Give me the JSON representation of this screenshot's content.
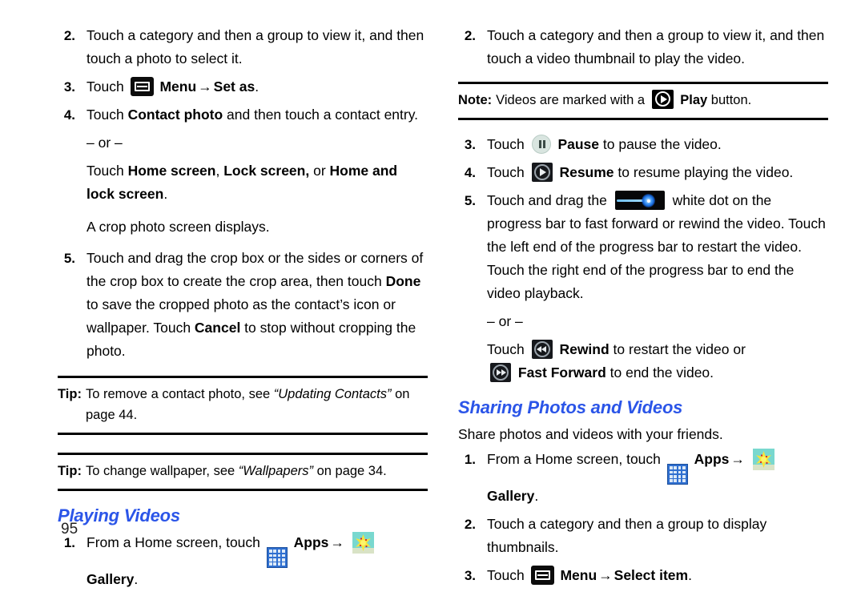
{
  "page_number": "95",
  "left_column": {
    "step2": {
      "num": "2.",
      "text_a": "Touch a category and then a group to view it, and then touch a photo to select it."
    },
    "step3": {
      "num": "3.",
      "lead": "Touch",
      "menu_label": "Menu",
      "arrow": "→",
      "target_label": "Set as",
      "period": "."
    },
    "step4": {
      "num": "4.",
      "lead": "Touch",
      "bold_a": "Contact photo",
      "tail": " and then touch a contact entry.",
      "or": "– or –",
      "alt_lead": "Touch ",
      "alt_b1": "Home screen",
      "alt_sep1": ", ",
      "alt_b2": "Lock screen,",
      "alt_sep2": " or ",
      "alt_b3": "Home and lock screen",
      "alt_period": ".",
      "result": "A crop photo screen displays."
    },
    "step5": {
      "num": "5.",
      "t1": "Touch and drag the crop box or the sides or corners of the crop box to create the crop area, then touch ",
      "b1": "Done",
      "t2": " to save the cropped photo as the contact’s icon or wallpaper. Touch ",
      "b2": "Cancel",
      "t3": " to stop without cropping the photo."
    },
    "tip1": {
      "label": "Tip:",
      "text_a": "To remove a contact photo, see ",
      "ref": "“Updating Contacts”",
      "text_b": " on page 44."
    },
    "tip2": {
      "label": "Tip:",
      "text_a": "To change wallpaper, see ",
      "ref": "“Wallpapers”",
      "text_b": " on page 34."
    },
    "heading_playing_videos": "Playing Videos",
    "pv_step1": {
      "num": "1.",
      "lead": "From a Home screen, touch",
      "apps_label": "Apps",
      "arrow": "→",
      "gallery_label": "Gallery",
      "period": "."
    }
  },
  "right_column": {
    "step2": {
      "num": "2.",
      "text_a": "Touch a category and then a group to view it, and then touch a video thumbnail to play the video."
    },
    "note": {
      "label": "Note:",
      "text_a": "Videos are marked with a",
      "bold": "Play",
      "text_b": " button."
    },
    "step3": {
      "num": "3.",
      "lead": "Touch",
      "bold": "Pause",
      "tail": " to pause the video."
    },
    "step4": {
      "num": "4.",
      "lead": "Touch",
      "bold": "Resume",
      "tail": " to resume playing the video."
    },
    "step5": {
      "num": "5.",
      "lead": "Touch and drag the",
      "tail": "white dot on the progress bar to fast forward or rewind the video. Touch the left end of the progress bar to restart the video. Touch the right end of the progress bar to end the video playback.",
      "or": "– or –",
      "alt_lead": "Touch",
      "alt_b1": "Rewind",
      "alt_mid": " to restart the video or",
      "alt_b2": "Fast Forward",
      "alt_tail": " to end the video."
    },
    "heading_sharing": "Sharing Photos and Videos",
    "intro": "Share photos and videos with your friends.",
    "sh_step1": {
      "num": "1.",
      "lead": "From a Home screen, touch",
      "apps_label": "Apps",
      "arrow": "→",
      "gallery_label": "Gallery",
      "period": "."
    },
    "sh_step2": {
      "num": "2.",
      "text": "Touch a category and then a group to display thumbnails."
    },
    "sh_step3": {
      "num": "3.",
      "lead": "Touch",
      "menu_label": "Menu",
      "arrow": "→",
      "target_label": "Select item",
      "period": "."
    }
  },
  "colors": {
    "heading_blue": "#2b55e8",
    "apps_icon_blue": "#2f6fd0",
    "gallery_bg": "#79d8cf",
    "gallery_flower": "#f5e53b"
  }
}
